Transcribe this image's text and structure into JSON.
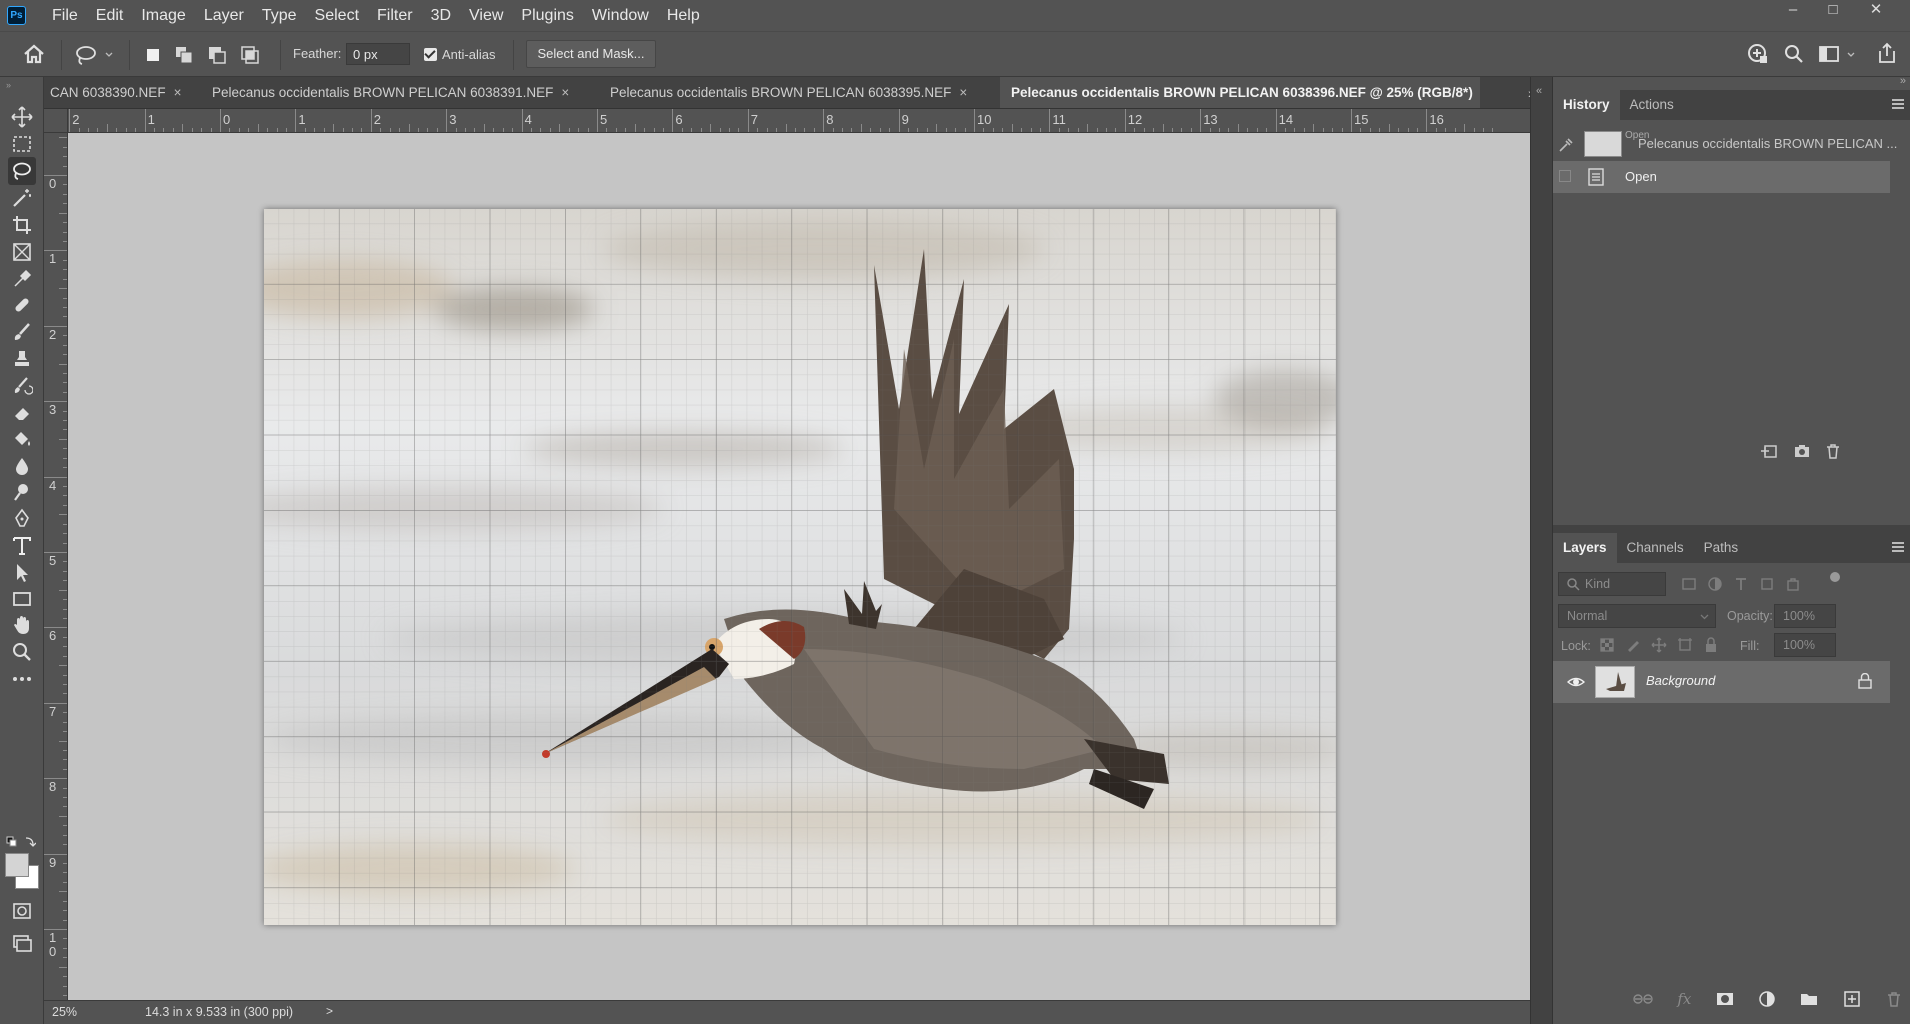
{
  "app": {
    "logo": "Ps"
  },
  "menu": [
    "File",
    "Edit",
    "Image",
    "Layer",
    "Type",
    "Select",
    "Filter",
    "3D",
    "View",
    "Plugins",
    "Window",
    "Help"
  ],
  "window_controls": {
    "minimize": "–",
    "maximize": "□",
    "close": "✕"
  },
  "options": {
    "feather_label": "Feather:",
    "feather_value": "0 px",
    "antialias_label": "Anti-alias",
    "antialias_checked": true,
    "select_mask_label": "Select and Mask..."
  },
  "tools": [
    {
      "name": "move-tool",
      "icon": "move-icon"
    },
    {
      "name": "marquee-tool",
      "icon": "rectangle-marquee-icon"
    },
    {
      "name": "lasso-tool",
      "icon": "lasso-icon",
      "active": true
    },
    {
      "name": "magic-wand-tool",
      "icon": "magic-wand-icon"
    },
    {
      "name": "crop-tool",
      "icon": "crop-icon"
    },
    {
      "name": "frame-tool",
      "icon": "frame-icon"
    },
    {
      "name": "eyedropper-tool",
      "icon": "eyedropper-icon"
    },
    {
      "name": "healing-brush-tool",
      "icon": "bandage-icon"
    },
    {
      "name": "brush-tool",
      "icon": "brush-icon"
    },
    {
      "name": "clone-stamp-tool",
      "icon": "stamp-icon"
    },
    {
      "name": "history-brush-tool",
      "icon": "history-brush-icon"
    },
    {
      "name": "eraser-tool",
      "icon": "eraser-icon"
    },
    {
      "name": "paint-bucket-tool",
      "icon": "paint-bucket-icon"
    },
    {
      "name": "blur-tool",
      "icon": "drop-icon"
    },
    {
      "name": "dodge-tool",
      "icon": "dodge-icon"
    },
    {
      "name": "pen-tool",
      "icon": "pen-icon"
    },
    {
      "name": "type-tool",
      "icon": "type-icon"
    },
    {
      "name": "path-selection-tool",
      "icon": "arrow-icon"
    },
    {
      "name": "rectangle-tool",
      "icon": "rectangle-icon"
    },
    {
      "name": "hand-tool",
      "icon": "hand-icon"
    },
    {
      "name": "zoom-tool",
      "icon": "zoom-icon"
    },
    {
      "name": "more-tools",
      "icon": "ellipsis-icon"
    }
  ],
  "tabs": [
    {
      "label": "CAN 6038390.NEF",
      "active": false
    },
    {
      "label": "Pelecanus occidentalis  BROWN PELICAN 6038391.NEF",
      "active": false
    },
    {
      "label": "Pelecanus occidentalis  BROWN PELICAN 6038395.NEF",
      "active": false
    },
    {
      "label": "Pelecanus occidentalis  BROWN PELICAN 6038396.NEF @ 25% (RGB/8*)",
      "active": true
    }
  ],
  "tab_close": "×",
  "ruler_h_labels": [
    "2",
    "1",
    "0",
    "1",
    "2",
    "3",
    "4",
    "5",
    "6",
    "7",
    "8",
    "9",
    "10",
    "11",
    "12",
    "13",
    "14",
    "15",
    "16"
  ],
  "ruler_v_labels": [
    "1",
    "0",
    "1",
    "2",
    "3",
    "4",
    "5",
    "6",
    "7",
    "8",
    "9",
    "1\n0"
  ],
  "status": {
    "zoom": "25%",
    "doc_size": "14.3 in x 9.533 in (300 ppi)",
    "arrow": ">"
  },
  "history_panel": {
    "tabs": [
      "History",
      "Actions"
    ],
    "snapshot_name": "Pelecanus occidentalis  BROWN PELICAN ...",
    "snapshot_overlay": "Open",
    "states": [
      "Open"
    ]
  },
  "layers_panel": {
    "tabs": [
      "Layers",
      "Channels",
      "Paths"
    ],
    "filter_placeholder": "Kind",
    "blend_mode": "Normal",
    "opacity_label": "Opacity:",
    "opacity_value": "100%",
    "lock_label": "Lock:",
    "fill_label": "Fill:",
    "fill_value": "100%",
    "layers": [
      {
        "name": "Background",
        "visible": true,
        "locked": true
      }
    ]
  },
  "colors": {
    "ui_bg": "#535353",
    "canvas_bg": "#c5c5c5",
    "accent": "#31a8ff"
  }
}
